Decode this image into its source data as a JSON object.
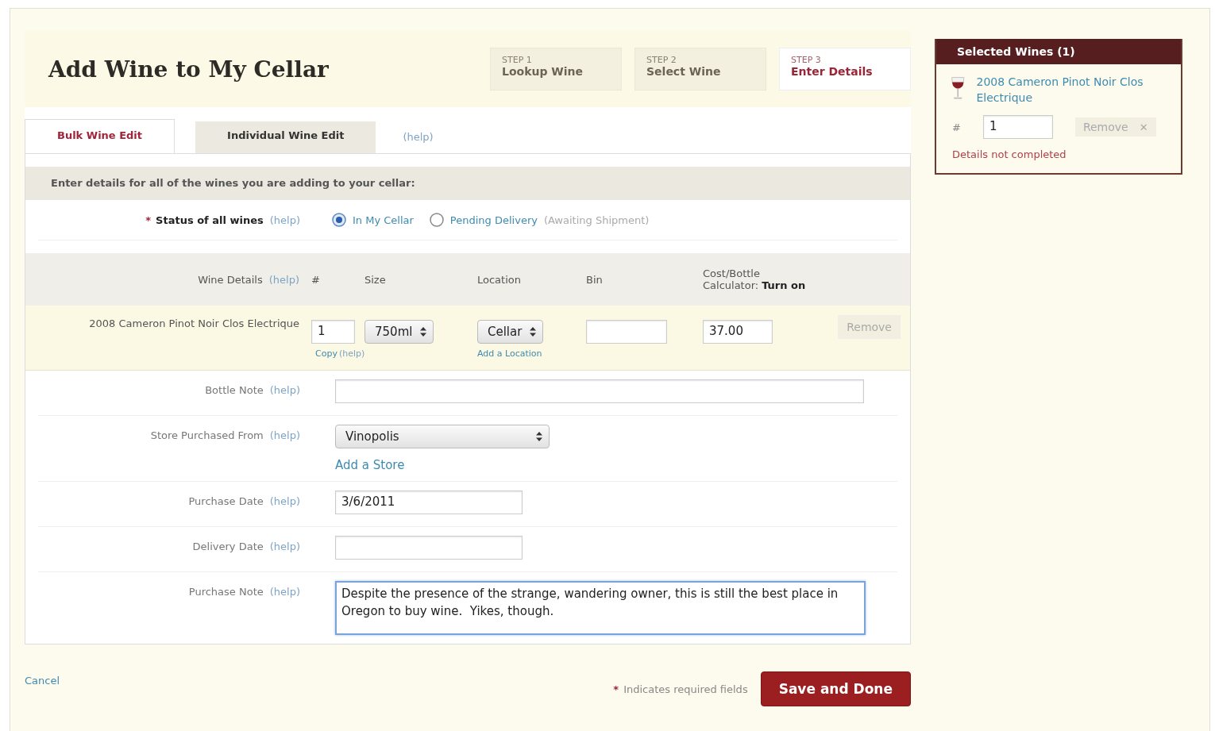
{
  "page": {
    "title": "Add Wine to My Cellar"
  },
  "steps": [
    {
      "step": "STEP 1",
      "label": "Lookup Wine",
      "selected": false
    },
    {
      "step": "STEP 2",
      "label": "Select Wine",
      "selected": false
    },
    {
      "step": "STEP 3",
      "label": "Enter Details",
      "selected": true
    }
  ],
  "tabs": [
    {
      "label": "Bulk Wine Edit",
      "selected": true
    },
    {
      "label": "Individual Wine Edit",
      "selected": false
    }
  ],
  "tabs_help": "(help)",
  "section_heading": "Enter details for all of the wines you are adding to your cellar:",
  "status": {
    "required_mark": "*",
    "label": "Status of all wines",
    "help": "(help)",
    "options": [
      {
        "label": "In My Cellar",
        "selected": true
      },
      {
        "label": "Pending Delivery",
        "note": "(Awaiting Shipment)",
        "selected": false
      }
    ]
  },
  "wine_table": {
    "columns": [
      {
        "label": "Wine Details",
        "help": "(help)"
      },
      {
        "label": "#"
      },
      {
        "label": "Size"
      },
      {
        "label": "Location"
      },
      {
        "label": "Bin"
      },
      {
        "label": "Cost/Bottle",
        "sub_label": "Calculator:",
        "link": "Turn on"
      }
    ],
    "rows": [
      {
        "wine": "2008 Cameron Pinot Noir Clos Electrique",
        "quantity": "1",
        "copy_link": "Copy",
        "copy_help": "(help)",
        "size": "750ml",
        "location": "Cellar",
        "add_location": "Add a Location",
        "cost": "37.00",
        "remove": "Remove"
      }
    ]
  },
  "fields": [
    {
      "kind": "note",
      "label": "Bottle Note",
      "help": "(help)"
    },
    {
      "kind": "select",
      "label": "Store Purchased From",
      "help": "(help)",
      "value": "Vinopolis",
      "link": "Add a Store"
    },
    {
      "kind": "date",
      "label": "Purchase Date",
      "help": "(help)",
      "value": "3/6/2011"
    },
    {
      "kind": "date",
      "label": "Delivery Date",
      "help": "(help)"
    },
    {
      "kind": "textarea",
      "label": "Purchase Note",
      "help": "(help)",
      "value": "Despite the presence of the strange, wandering owner, this is still the best place in Oregon to buy wine.  Yikes, though.",
      "focused": true
    }
  ],
  "footer": {
    "cancel": "Cancel",
    "required_mark": "*",
    "required_note": "Indicates required fields",
    "save": "Save and Done"
  },
  "sidebar": {
    "title": "Selected Wines (1)",
    "items": [
      {
        "name": "2008 Cameron Pinot Noir Clos Electrique",
        "quantity_label": "#",
        "quantity": "1",
        "remove": "Remove",
        "remove_mark": "✕",
        "status": "Details not completed"
      }
    ]
  }
}
